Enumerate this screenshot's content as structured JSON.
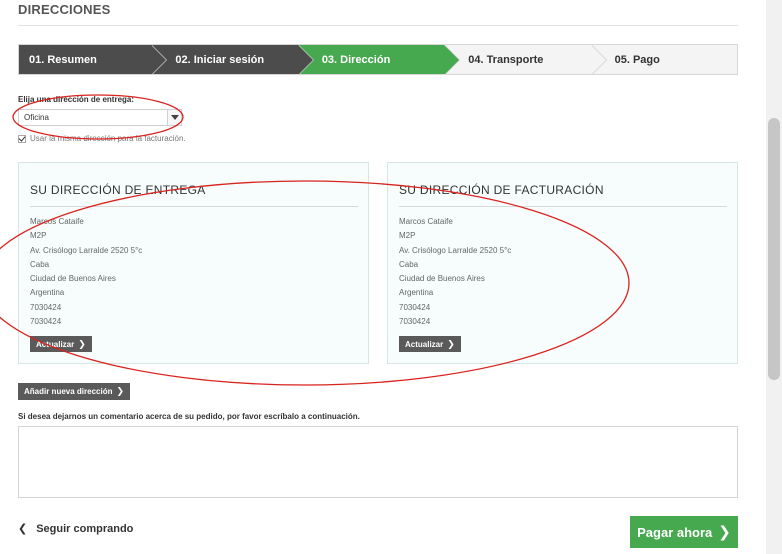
{
  "page": {
    "title": "DIRECCIONES"
  },
  "steps": [
    {
      "label": "01. Resumen",
      "state": "done"
    },
    {
      "label": "02. Iniciar sesión",
      "state": "done"
    },
    {
      "label": "03. Dirección",
      "state": "current"
    },
    {
      "label": "04. Transporte",
      "state": "todo"
    },
    {
      "label": "05. Pago",
      "state": "todo"
    }
  ],
  "delivery": {
    "label": "Elija una dirección de entrega:",
    "selected": "Oficina",
    "same_address_label": "Usar la misma dirección para la facturación.",
    "same_address_checked": true
  },
  "shipping_address": {
    "title": "SU DIRECCIÓN DE ENTREGA",
    "lines": [
      "Marcos Cataife",
      "M2P",
      "Av. Crisólogo Larralde 2520 5°c",
      "Caba",
      "Ciudad de Buenos Aires",
      "Argentina",
      "7030424",
      "7030424"
    ],
    "update_label": "Actualizar"
  },
  "billing_address": {
    "title": "SU DIRECCIÓN DE FACTURACIÓN",
    "lines": [
      "Marcos Cataife",
      "M2P",
      "Av. Crisólogo Larralde 2520 5°c",
      "Caba",
      "Ciudad de Buenos Aires",
      "Argentina",
      "7030424",
      "7030424"
    ],
    "update_label": "Actualizar"
  },
  "add_address_label": "Añadir nueva dirección",
  "comment": {
    "label": "Si desea dejarnos un comentario acerca de su pedido, por favor escríbalo a continuación.",
    "value": ""
  },
  "footer": {
    "continue_label": "Seguir comprando",
    "pay_label": "Pagar ahora"
  },
  "colors": {
    "step_done": "#4c4c4c",
    "step_current": "#46a84f",
    "step_todo": "#f4f4f4",
    "address_bg": "#f6fdfc",
    "annotation": "#d9231f"
  },
  "icons": {
    "select_toggle": "triangle-down-icon",
    "checkbox": "checkmark-icon",
    "button_arrow": "chevron-right-icon",
    "back_arrow": "chevron-left-icon"
  }
}
